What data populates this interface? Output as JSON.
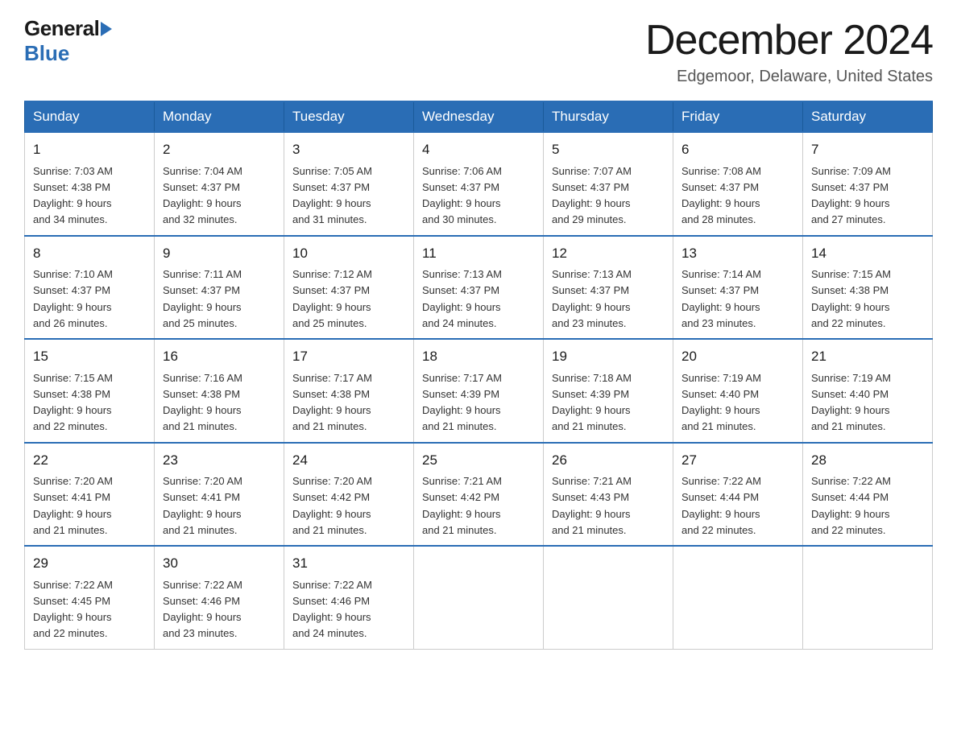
{
  "logo": {
    "general": "General",
    "blue": "Blue"
  },
  "header": {
    "month": "December 2024",
    "location": "Edgemoor, Delaware, United States"
  },
  "weekdays": [
    "Sunday",
    "Monday",
    "Tuesday",
    "Wednesday",
    "Thursday",
    "Friday",
    "Saturday"
  ],
  "weeks": [
    [
      {
        "day": "1",
        "sunrise": "7:03 AM",
        "sunset": "4:38 PM",
        "daylight": "9 hours and 34 minutes."
      },
      {
        "day": "2",
        "sunrise": "7:04 AM",
        "sunset": "4:37 PM",
        "daylight": "9 hours and 32 minutes."
      },
      {
        "day": "3",
        "sunrise": "7:05 AM",
        "sunset": "4:37 PM",
        "daylight": "9 hours and 31 minutes."
      },
      {
        "day": "4",
        "sunrise": "7:06 AM",
        "sunset": "4:37 PM",
        "daylight": "9 hours and 30 minutes."
      },
      {
        "day": "5",
        "sunrise": "7:07 AM",
        "sunset": "4:37 PM",
        "daylight": "9 hours and 29 minutes."
      },
      {
        "day": "6",
        "sunrise": "7:08 AM",
        "sunset": "4:37 PM",
        "daylight": "9 hours and 28 minutes."
      },
      {
        "day": "7",
        "sunrise": "7:09 AM",
        "sunset": "4:37 PM",
        "daylight": "9 hours and 27 minutes."
      }
    ],
    [
      {
        "day": "8",
        "sunrise": "7:10 AM",
        "sunset": "4:37 PM",
        "daylight": "9 hours and 26 minutes."
      },
      {
        "day": "9",
        "sunrise": "7:11 AM",
        "sunset": "4:37 PM",
        "daylight": "9 hours and 25 minutes."
      },
      {
        "day": "10",
        "sunrise": "7:12 AM",
        "sunset": "4:37 PM",
        "daylight": "9 hours and 25 minutes."
      },
      {
        "day": "11",
        "sunrise": "7:13 AM",
        "sunset": "4:37 PM",
        "daylight": "9 hours and 24 minutes."
      },
      {
        "day": "12",
        "sunrise": "7:13 AM",
        "sunset": "4:37 PM",
        "daylight": "9 hours and 23 minutes."
      },
      {
        "day": "13",
        "sunrise": "7:14 AM",
        "sunset": "4:37 PM",
        "daylight": "9 hours and 23 minutes."
      },
      {
        "day": "14",
        "sunrise": "7:15 AM",
        "sunset": "4:38 PM",
        "daylight": "9 hours and 22 minutes."
      }
    ],
    [
      {
        "day": "15",
        "sunrise": "7:15 AM",
        "sunset": "4:38 PM",
        "daylight": "9 hours and 22 minutes."
      },
      {
        "day": "16",
        "sunrise": "7:16 AM",
        "sunset": "4:38 PM",
        "daylight": "9 hours and 21 minutes."
      },
      {
        "day": "17",
        "sunrise": "7:17 AM",
        "sunset": "4:38 PM",
        "daylight": "9 hours and 21 minutes."
      },
      {
        "day": "18",
        "sunrise": "7:17 AM",
        "sunset": "4:39 PM",
        "daylight": "9 hours and 21 minutes."
      },
      {
        "day": "19",
        "sunrise": "7:18 AM",
        "sunset": "4:39 PM",
        "daylight": "9 hours and 21 minutes."
      },
      {
        "day": "20",
        "sunrise": "7:19 AM",
        "sunset": "4:40 PM",
        "daylight": "9 hours and 21 minutes."
      },
      {
        "day": "21",
        "sunrise": "7:19 AM",
        "sunset": "4:40 PM",
        "daylight": "9 hours and 21 minutes."
      }
    ],
    [
      {
        "day": "22",
        "sunrise": "7:20 AM",
        "sunset": "4:41 PM",
        "daylight": "9 hours and 21 minutes."
      },
      {
        "day": "23",
        "sunrise": "7:20 AM",
        "sunset": "4:41 PM",
        "daylight": "9 hours and 21 minutes."
      },
      {
        "day": "24",
        "sunrise": "7:20 AM",
        "sunset": "4:42 PM",
        "daylight": "9 hours and 21 minutes."
      },
      {
        "day": "25",
        "sunrise": "7:21 AM",
        "sunset": "4:42 PM",
        "daylight": "9 hours and 21 minutes."
      },
      {
        "day": "26",
        "sunrise": "7:21 AM",
        "sunset": "4:43 PM",
        "daylight": "9 hours and 21 minutes."
      },
      {
        "day": "27",
        "sunrise": "7:22 AM",
        "sunset": "4:44 PM",
        "daylight": "9 hours and 22 minutes."
      },
      {
        "day": "28",
        "sunrise": "7:22 AM",
        "sunset": "4:44 PM",
        "daylight": "9 hours and 22 minutes."
      }
    ],
    [
      {
        "day": "29",
        "sunrise": "7:22 AM",
        "sunset": "4:45 PM",
        "daylight": "9 hours and 22 minutes."
      },
      {
        "day": "30",
        "sunrise": "7:22 AM",
        "sunset": "4:46 PM",
        "daylight": "9 hours and 23 minutes."
      },
      {
        "day": "31",
        "sunrise": "7:22 AM",
        "sunset": "4:46 PM",
        "daylight": "9 hours and 24 minutes."
      },
      null,
      null,
      null,
      null
    ]
  ],
  "labels": {
    "sunrise": "Sunrise:",
    "sunset": "Sunset:",
    "daylight": "Daylight:"
  }
}
